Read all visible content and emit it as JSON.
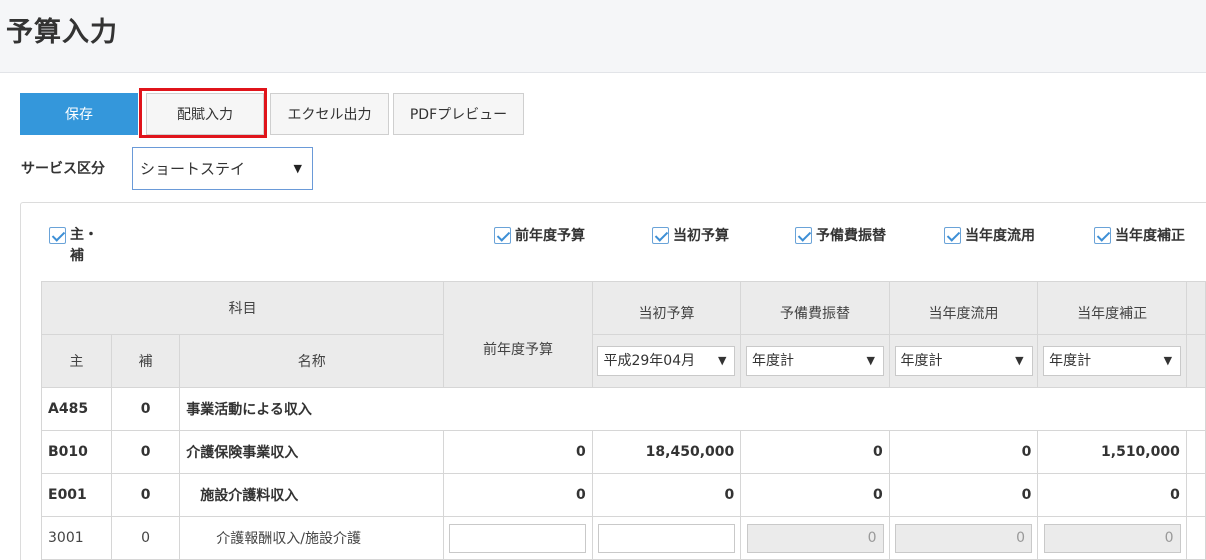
{
  "page": {
    "title": "予算入力"
  },
  "toolbar": {
    "save_label": "保存",
    "haifu_label": "配賦入力",
    "excel_label": "エクセル出力",
    "pdf_label": "PDFプレビュー"
  },
  "service": {
    "label": "サービス区分",
    "selected": "ショートステイ"
  },
  "checkboxes": {
    "main_sub_line1": "主・",
    "main_sub_line2": "補",
    "prev_year": "前年度予算",
    "initial": "当初予算",
    "reserve": "予備費振替",
    "diversion": "当年度流用",
    "correction": "当年度補正"
  },
  "table": {
    "headers": {
      "subject": "科目",
      "main": "主",
      "sub": "補",
      "name": "名称",
      "prev_year": "前年度予算",
      "initial": "当初予算",
      "reserve": "予備費振替",
      "diversion": "当年度流用",
      "correction": "当年度補正"
    },
    "selects": {
      "initial": "平成29年04月",
      "reserve": "年度計",
      "diversion": "年度計",
      "correction": "年度計"
    },
    "rows": [
      {
        "main": "A485",
        "sub": "0",
        "name": "事業活動による収入"
      },
      {
        "main": "B010",
        "sub": "0",
        "name": "介護保険事業収入",
        "prev": "0",
        "initial": "18,450,000",
        "reserve": "0",
        "diversion": "0",
        "correction": "1,510,000"
      },
      {
        "main": "E001",
        "sub": "0",
        "name": "施設介護料収入",
        "prev": "0",
        "initial": "0",
        "reserve": "0",
        "diversion": "0",
        "correction": "0"
      },
      {
        "main": "3001",
        "sub": "0",
        "name": "介護報酬収入/施設介護",
        "reserve": "0",
        "diversion": "0",
        "correction": "0"
      }
    ]
  }
}
